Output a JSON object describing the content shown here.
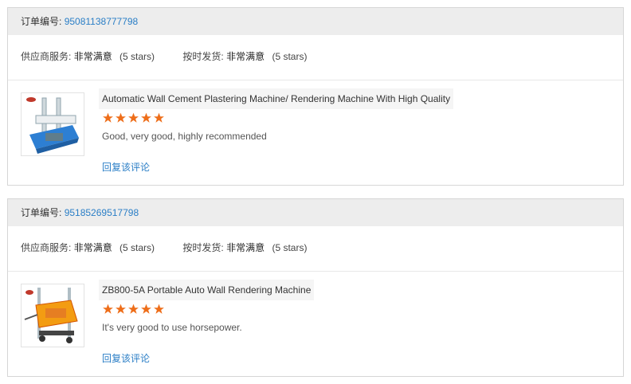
{
  "labels": {
    "order_no": "订单编号:",
    "supplier_service": "供应商服务:",
    "on_time_delivery": "按时发货:",
    "reply": "回复该评论"
  },
  "colors": {
    "star": "#ee6e1a",
    "link": "#2a7ec6",
    "header_bg": "#ededed"
  },
  "reviews": [
    {
      "order_no": "95081138777798",
      "supplier_service": {
        "value": "非常满意",
        "stars": "(5 stars)"
      },
      "on_time_delivery": {
        "value": "非常满意",
        "stars": "(5 stars)"
      },
      "product_title": "Automatic Wall Cement Plastering Machine/ Rendering Machine With High Quality",
      "rating": 5,
      "text": "Good, very good, highly recommended",
      "thumb_icon": "plastering-machine-blue"
    },
    {
      "order_no": "95185269517798",
      "supplier_service": {
        "value": "非常满意",
        "stars": "(5 stars)"
      },
      "on_time_delivery": {
        "value": "非常满意",
        "stars": "(5 stars)"
      },
      "product_title": "ZB800-5A Portable Auto Wall Rendering Machine",
      "rating": 5,
      "text": "It's very good to use horsepower.",
      "thumb_icon": "rendering-machine-orange"
    }
  ]
}
